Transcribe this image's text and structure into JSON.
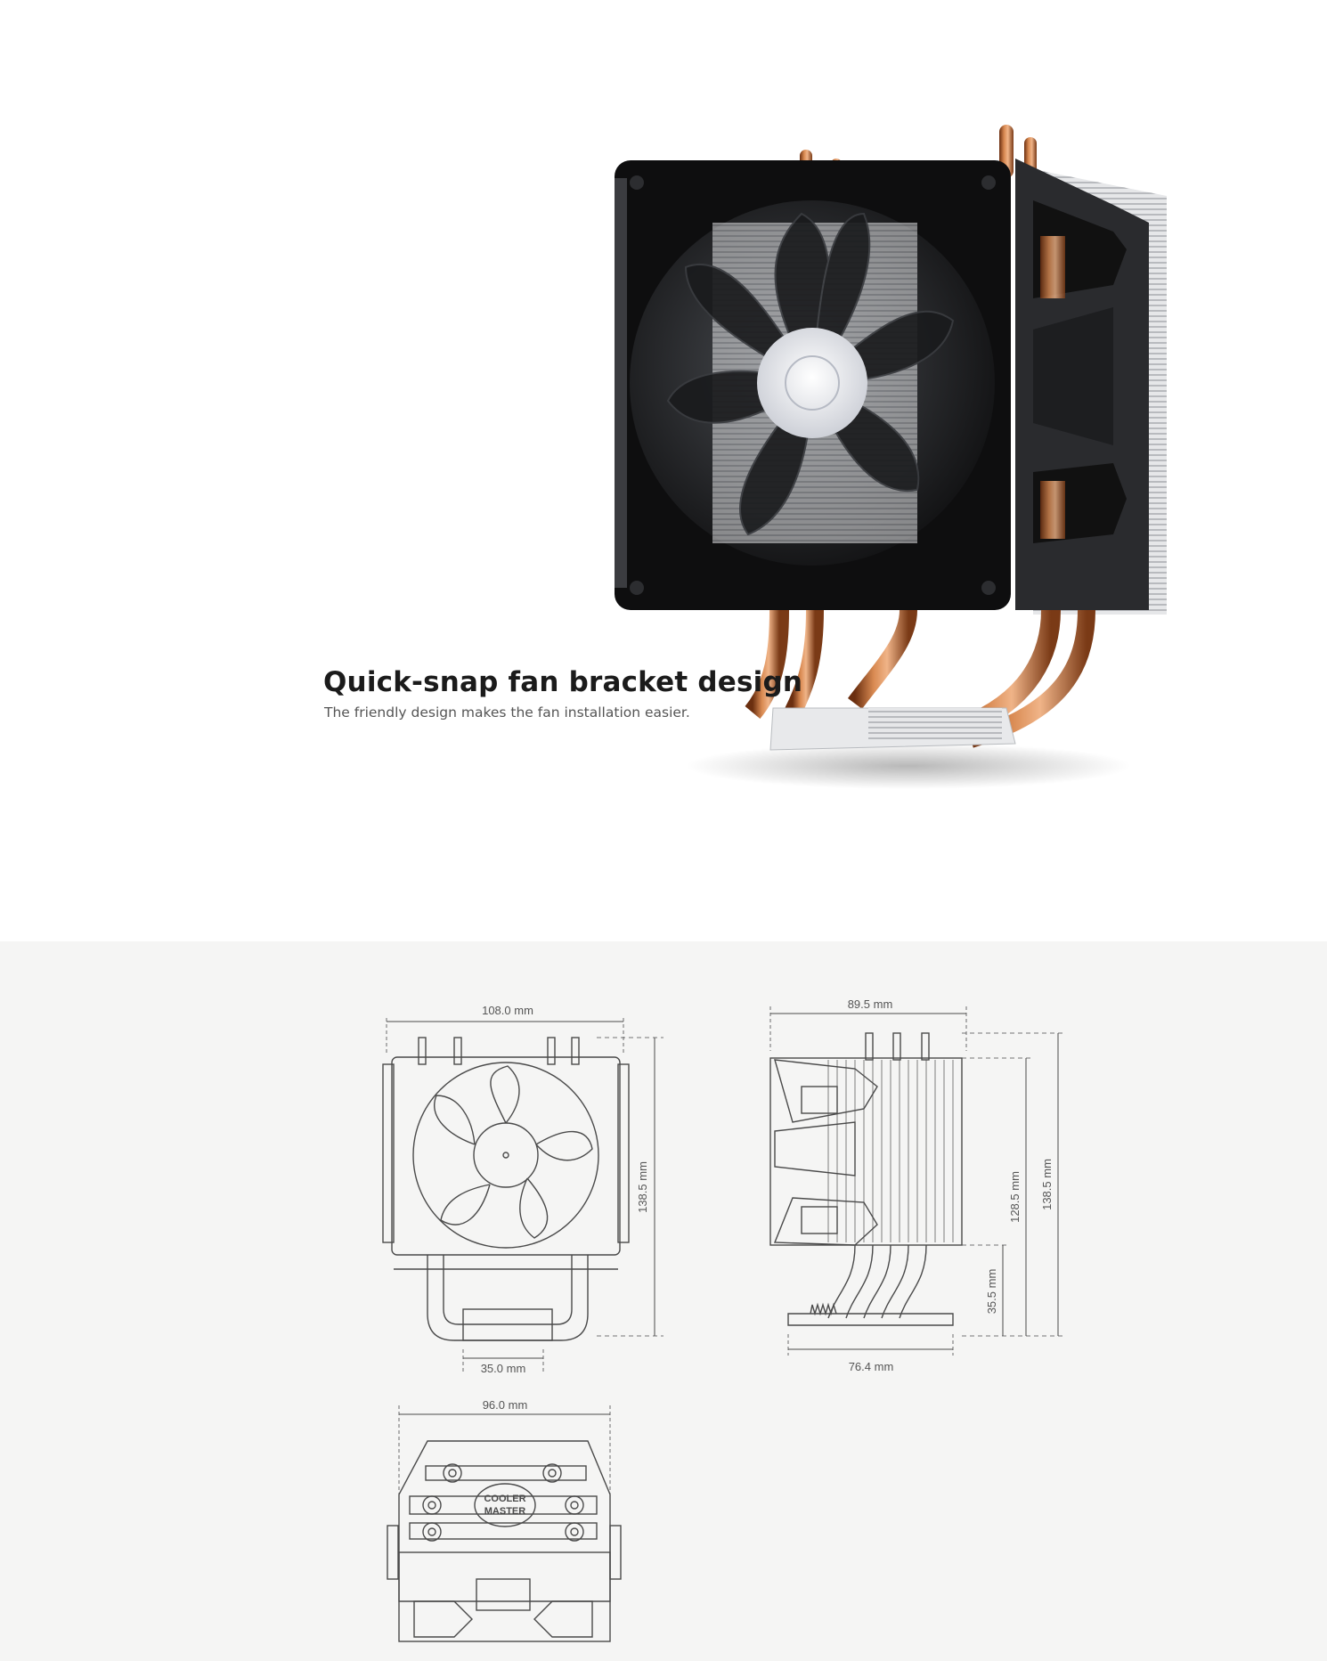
{
  "feature": {
    "title": "Quick-snap fan bracket design",
    "description": "The friendly design makes the fan installation easier."
  },
  "dimensions": {
    "front_width": "108.0 mm",
    "front_height": "138.5 mm",
    "front_base_width": "35.0 mm",
    "side_width": "89.5 mm",
    "side_fin_height": "128.5 mm",
    "side_total_height": "138.5 mm",
    "side_pipe_height": "35.5 mm",
    "side_base_width": "76.4 mm",
    "bottom_width": "96.0 mm"
  },
  "logo": {
    "line1": "COOLER",
    "line2": "MASTER"
  },
  "colors": {
    "top_background": "#ffffff",
    "bottom_background": "#f5f5f4",
    "copper": "#c8743f",
    "fan_black": "#111111",
    "line_drawing": "#4a4a4a"
  }
}
